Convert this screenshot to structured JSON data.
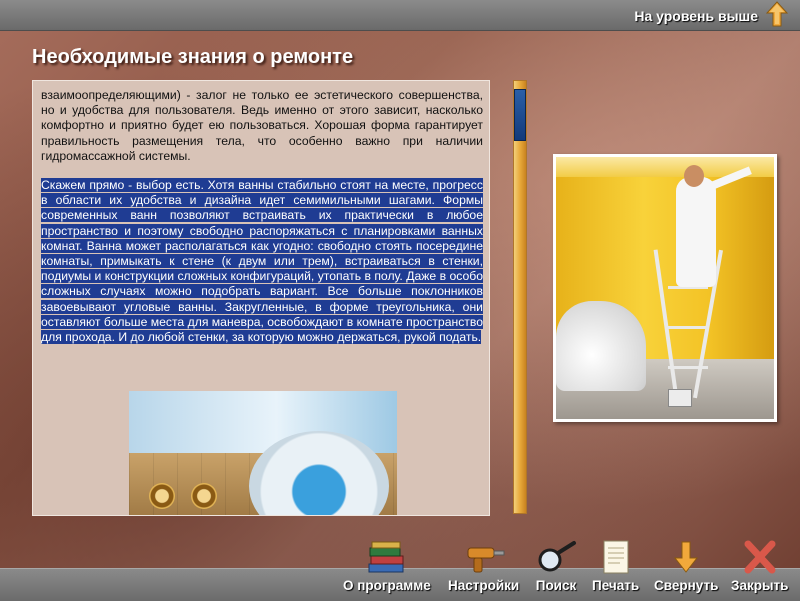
{
  "header": {
    "up_level_label": "На уровень выше"
  },
  "main": {
    "title": "Необходимые знания о ремонте",
    "paragraph_1": "взаимоопределяющими) - залог не только ее эстетического совершенства, но и удобства для пользователя. Ведь именно от этого зависит, насколько комфортно и приятно будет ею пользоваться. Хорошая форма гарантирует правильность размещения тела, что особенно важно при наличии гидромассажной системы.",
    "paragraph_2": "Скажем прямо - выбор есть. Хотя ванны стабильно стоят на месте, прогресс в области их удобства и дизайна идет семимильными шагами. Формы современных ванн позволяют встраивать их практически в любое пространство и поэтому свободно распоряжаться с планировками ванных комнат. Ванна может располагаться как угодно: свободно стоять посередине комнаты, примыкать к стене (к двум или трем), встраиваться в стенки, подиумы и конструкции сложных конфигураций, утопать в полу. Даже в особо сложных случаях можно подобрать вариант. Все больше поклонников завоевывают угловые ванны. Закругленные, в форме треугольника, они оставляют больше места для маневра, освобождают в комнате пространство для прохода. И до любой стенки, за которую можно держаться, рукой подать."
  },
  "toolbar": {
    "about_label": "О программе",
    "settings_label": "Настройки",
    "search_label": "Поиск",
    "print_label": "Печать",
    "minimize_label": "Свернуть",
    "close_label": "Закрыть"
  },
  "icons": {
    "up_level": "arrow-up-icon",
    "about": "books-icon",
    "settings": "drill-icon",
    "search": "magnifier-icon",
    "print": "paper-icon",
    "minimize": "arrow-down-icon",
    "close": "cross-icon"
  },
  "colors": {
    "accent_arrow": "#f2a93b",
    "selection": "#1f3c93",
    "close_cross": "#d9584a"
  }
}
